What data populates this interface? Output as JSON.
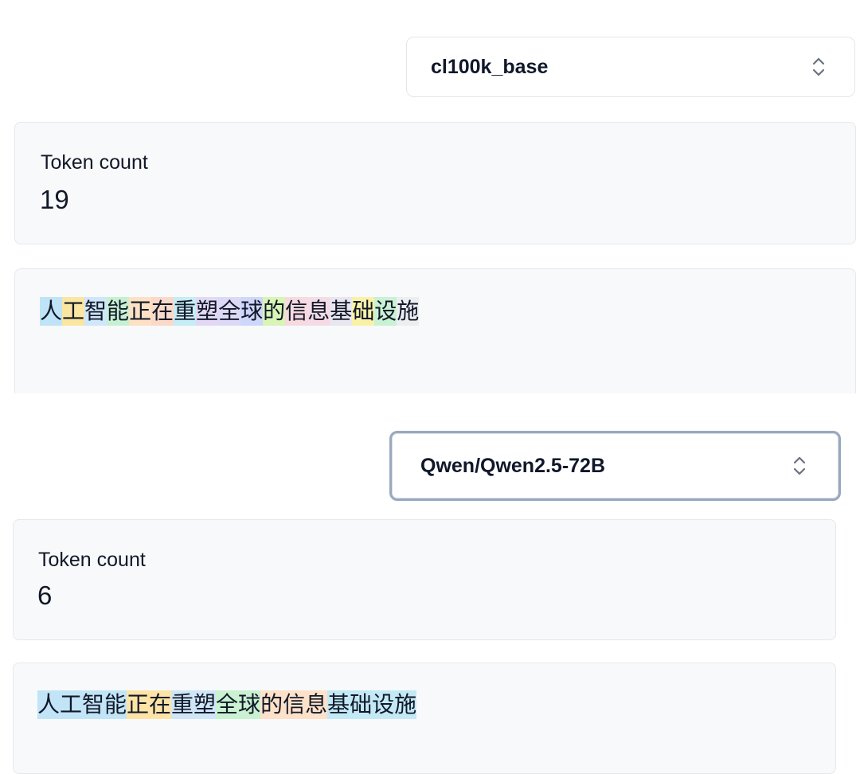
{
  "panel_top": {
    "tokenizer_select": {
      "value": "cl100k_base",
      "icon": "chevron-up-down-icon"
    },
    "token_count_label": "Token count",
    "token_count_value": "19",
    "tokens": [
      {
        "text": "人",
        "color": "#bfe3f7"
      },
      {
        "text": "工",
        "color": "#fae6a0"
      },
      {
        "text": "智",
        "color": "#cfe6fb"
      },
      {
        "text": "能",
        "color": "#c7f0d2"
      },
      {
        "text": "正",
        "color": "#fde1c4"
      },
      {
        "text": "在",
        "color": "#fad9c8"
      },
      {
        "text": "重",
        "color": "#c6ecf5"
      },
      {
        "text": "塑",
        "color": "#e2d8f6"
      },
      {
        "text": "全",
        "color": "#dcd9f7"
      },
      {
        "text": "球",
        "color": "#cfd6fb"
      },
      {
        "text": "的",
        "color": "#d8f4b6"
      },
      {
        "text": "信",
        "color": "#f7d9e0"
      },
      {
        "text": "息",
        "color": "#f5dbe6"
      },
      {
        "text": "基",
        "color": "#e9e6f0"
      },
      {
        "text": "础",
        "color": "#f9f1a8"
      },
      {
        "text": "设",
        "color": "#c9f1d4"
      },
      {
        "text": "施",
        "color": "#eceef0"
      }
    ]
  },
  "panel_bottom": {
    "tokenizer_select": {
      "value": "Qwen/Qwen2.5-72B",
      "icon": "chevron-up-down-icon"
    },
    "token_count_label": "Token count",
    "token_count_value": "6",
    "tokens": [
      {
        "text": "人工智能",
        "color": "#c2e4f7"
      },
      {
        "text": "正在",
        "color": "#fde3a6"
      },
      {
        "text": "重塑",
        "color": "#cfe6f9"
      },
      {
        "text": "全球",
        "color": "#c9f1d2"
      },
      {
        "text": "的信息",
        "color": "#fde1c8"
      },
      {
        "text": "基础设施",
        "color": "#c3e9f6"
      }
    ]
  }
}
